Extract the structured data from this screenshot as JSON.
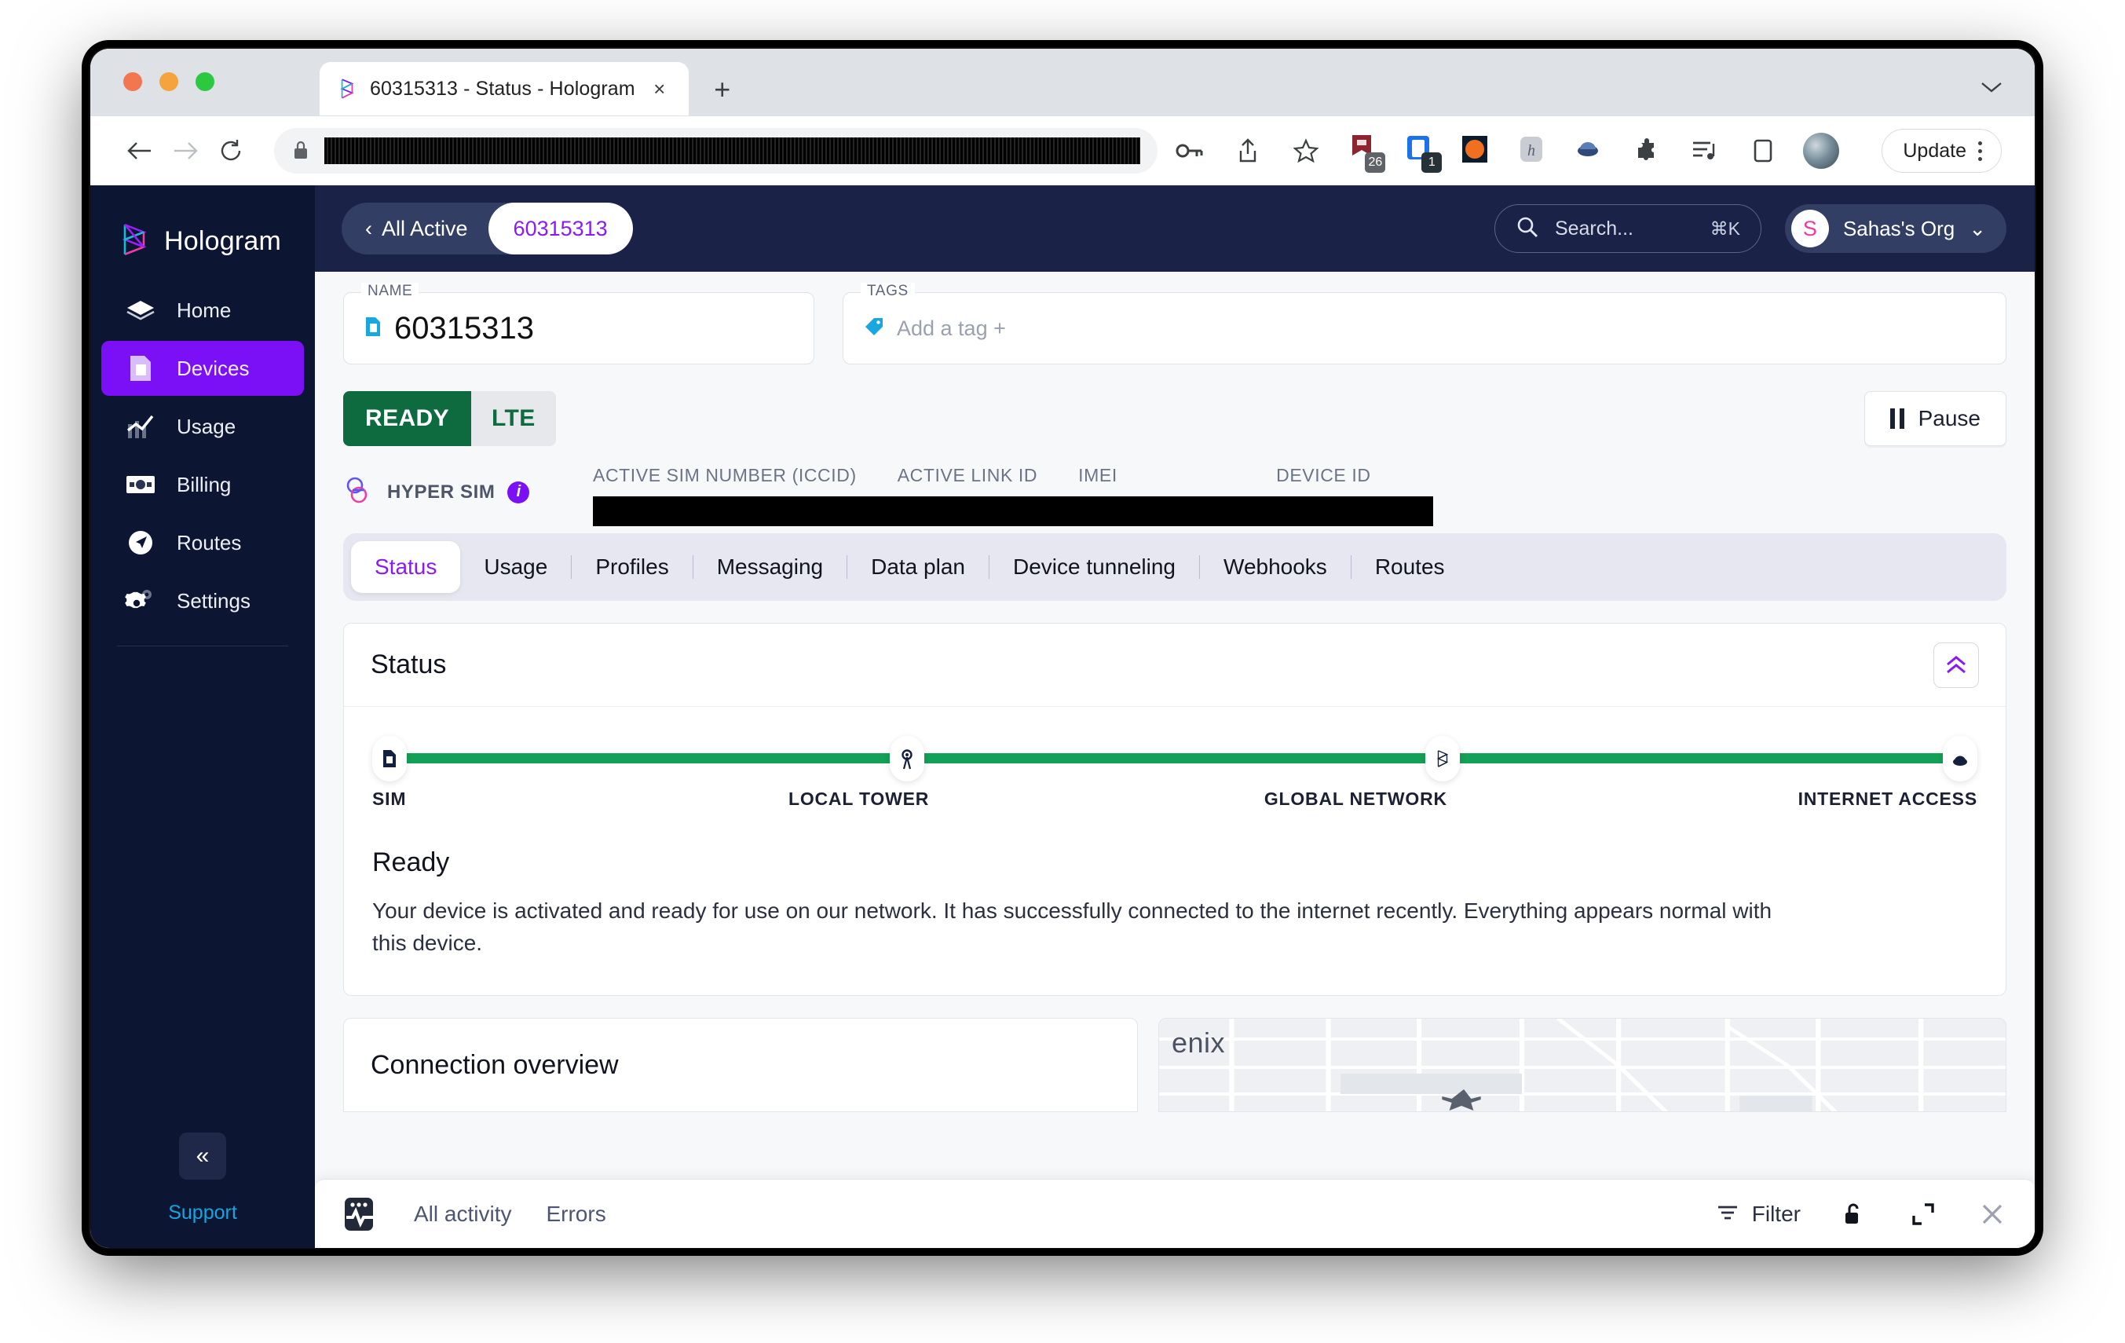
{
  "browser": {
    "tab": {
      "title": "60315313 - Status - Hologram",
      "favicon": "hologram-icon",
      "close": "×"
    },
    "new_tab": "+",
    "omnibox": {
      "value": "",
      "redacted": true,
      "lock": "lock-icon"
    },
    "toolbar_icons": [
      "key-icon",
      "share-icon",
      "bookmark-star-icon",
      "extension-calendar-icon",
      "extension-tabs-icon",
      "extension-colorwheel-icon",
      "extension-h-icon",
      "extension-cloud-icon",
      "puzzle-icon",
      "reading-list-icon",
      "side-panel-icon",
      "profile-avatar"
    ],
    "badges": {
      "calendar": "26",
      "tabs": "1"
    },
    "update_label": "Update",
    "menu": "kebab-menu-icon"
  },
  "sidebar": {
    "brand": "Hologram",
    "items": [
      {
        "label": "Home",
        "icon": "layers-icon",
        "active": false
      },
      {
        "label": "Devices",
        "icon": "sim-card-icon",
        "active": true
      },
      {
        "label": "Usage",
        "icon": "chart-line-icon",
        "active": false
      },
      {
        "label": "Billing",
        "icon": "billing-card-icon",
        "active": false
      },
      {
        "label": "Routes",
        "icon": "navigation-arrow-icon",
        "active": false
      },
      {
        "label": "Settings",
        "icon": "gear-icon",
        "active": false
      }
    ],
    "collapse": "«",
    "support": "Support"
  },
  "topbar": {
    "breadcrumb_back": "All Active",
    "breadcrumb_back_icon": "‹",
    "breadcrumb_current": "60315313",
    "search": {
      "placeholder": "Search...",
      "shortcut": "⌘K",
      "icon": "search-icon"
    },
    "org": {
      "initial": "S",
      "name": "Sahas's Org",
      "chevron": "⌄"
    }
  },
  "device": {
    "name_label": "NAME",
    "name_value": "60315313",
    "name_icon": "sim-card-icon",
    "tags_label": "TAGS",
    "tags_placeholder": "Add a tag +",
    "tags_icon": "tag-icon",
    "status_pill": "READY",
    "network_pill": "LTE",
    "pause_label": "Pause",
    "hyper_sim_label": "HYPER SIM",
    "hyper_sim_info": "i",
    "id_columns": [
      {
        "label": "ACTIVE SIM NUMBER (ICCID)",
        "value": "",
        "redacted": true
      },
      {
        "label": "ACTIVE LINK ID",
        "value": "",
        "redacted": true
      },
      {
        "label": "IMEI",
        "value": "",
        "redacted": true
      },
      {
        "label": "DEVICE ID",
        "value": "",
        "redacted": true
      }
    ]
  },
  "tabs": {
    "active": "Status",
    "items": [
      "Status",
      "Usage",
      "Profiles",
      "Messaging",
      "Data plan",
      "Device tunneling",
      "Webhooks",
      "Routes"
    ]
  },
  "status_card": {
    "title": "Status",
    "collapse_icon": "chevron-double-up-icon",
    "progress": {
      "percent": 100,
      "color": "#12a156",
      "nodes": [
        {
          "label": "SIM",
          "icon": "sim-card-icon"
        },
        {
          "label": "LOCAL TOWER",
          "icon": "cell-tower-icon"
        },
        {
          "label": "GLOBAL NETWORK",
          "icon": "hologram-icon"
        },
        {
          "label": "INTERNET ACCESS",
          "icon": "cloud-icon"
        }
      ]
    },
    "heading": "Ready",
    "description": "Your device is activated and ready for use on our network. It has successfully connected to the internet recently. Everything appears normal with this device."
  },
  "connection_card": {
    "title": "Connection overview"
  },
  "map_card": {
    "label": "enix"
  },
  "activity_bar": {
    "icon": "activity-monitor-icon",
    "links": [
      "All activity",
      "Errors"
    ],
    "filter_label": "Filter",
    "filter_icon": "filter-icon",
    "lock_icon": "unlock-icon",
    "expand_icon": "expand-icon",
    "close_icon": "×"
  },
  "colors": {
    "brand_purple": "#7b0ff5",
    "accent_purple": "#8b19f5",
    "sidebar_bg": "#0c1532",
    "topbar_bg": "#1a2347",
    "ready_green": "#0d6b3f",
    "progress_green": "#12a156",
    "support_blue": "#13a6e0",
    "pink": "#ef3aa0"
  }
}
